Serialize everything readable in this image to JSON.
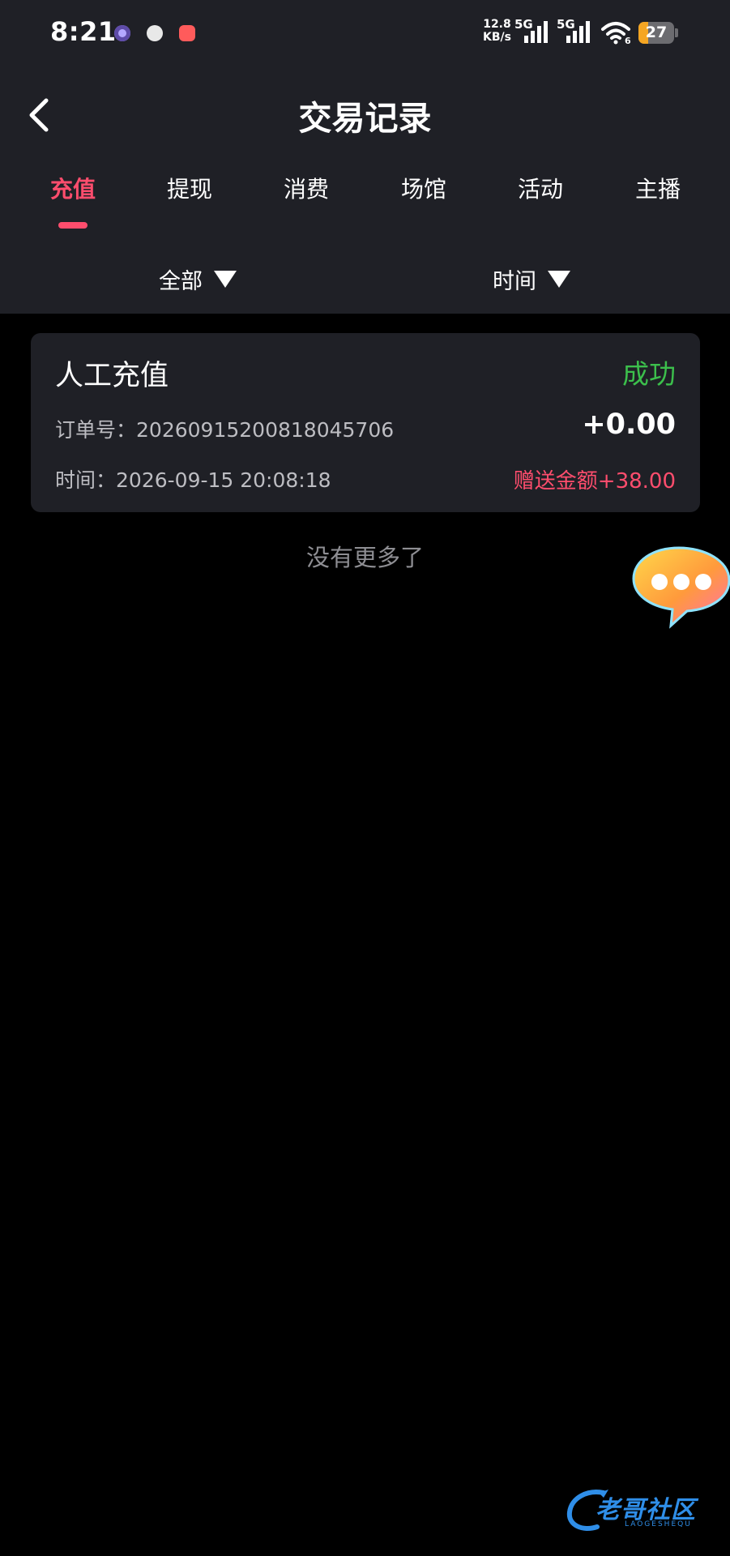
{
  "status_bar": {
    "time": "8:21",
    "network_speed_value": "12.8",
    "network_speed_unit": "KB/s",
    "network_1": "5G",
    "network_2": "5G",
    "wifi_sub": "6",
    "battery": "27",
    "battery_level_percent": 27,
    "notification_icons": [
      "browser-icon",
      "bird-icon",
      "red-app-icon"
    ]
  },
  "header": {
    "back_icon": "chevron-left-icon",
    "title": "交易记录"
  },
  "tabs": [
    {
      "label": "充值",
      "active": true
    },
    {
      "label": "提现",
      "active": false
    },
    {
      "label": "消费",
      "active": false
    },
    {
      "label": "场馆",
      "active": false
    },
    {
      "label": "活动",
      "active": false
    },
    {
      "label": "主播",
      "active": false
    }
  ],
  "filters": {
    "type_label": "全部",
    "time_label": "时间"
  },
  "records": [
    {
      "type": "人工充值",
      "status": "成功",
      "order_label": "订单号：",
      "order_no": "20260915200818045706",
      "amount": "+0.00",
      "time_label": "时间：",
      "time": "2026-09-15 20:08:18",
      "bonus": "赠送金额+38.00"
    }
  ],
  "list_end_text": "没有更多了",
  "floating_button_icon": "chat-bubble-icon",
  "colors": {
    "accent": "#ff4d6d",
    "success": "#3cbf4c",
    "panel": "#1f2026",
    "background": "#000000"
  }
}
